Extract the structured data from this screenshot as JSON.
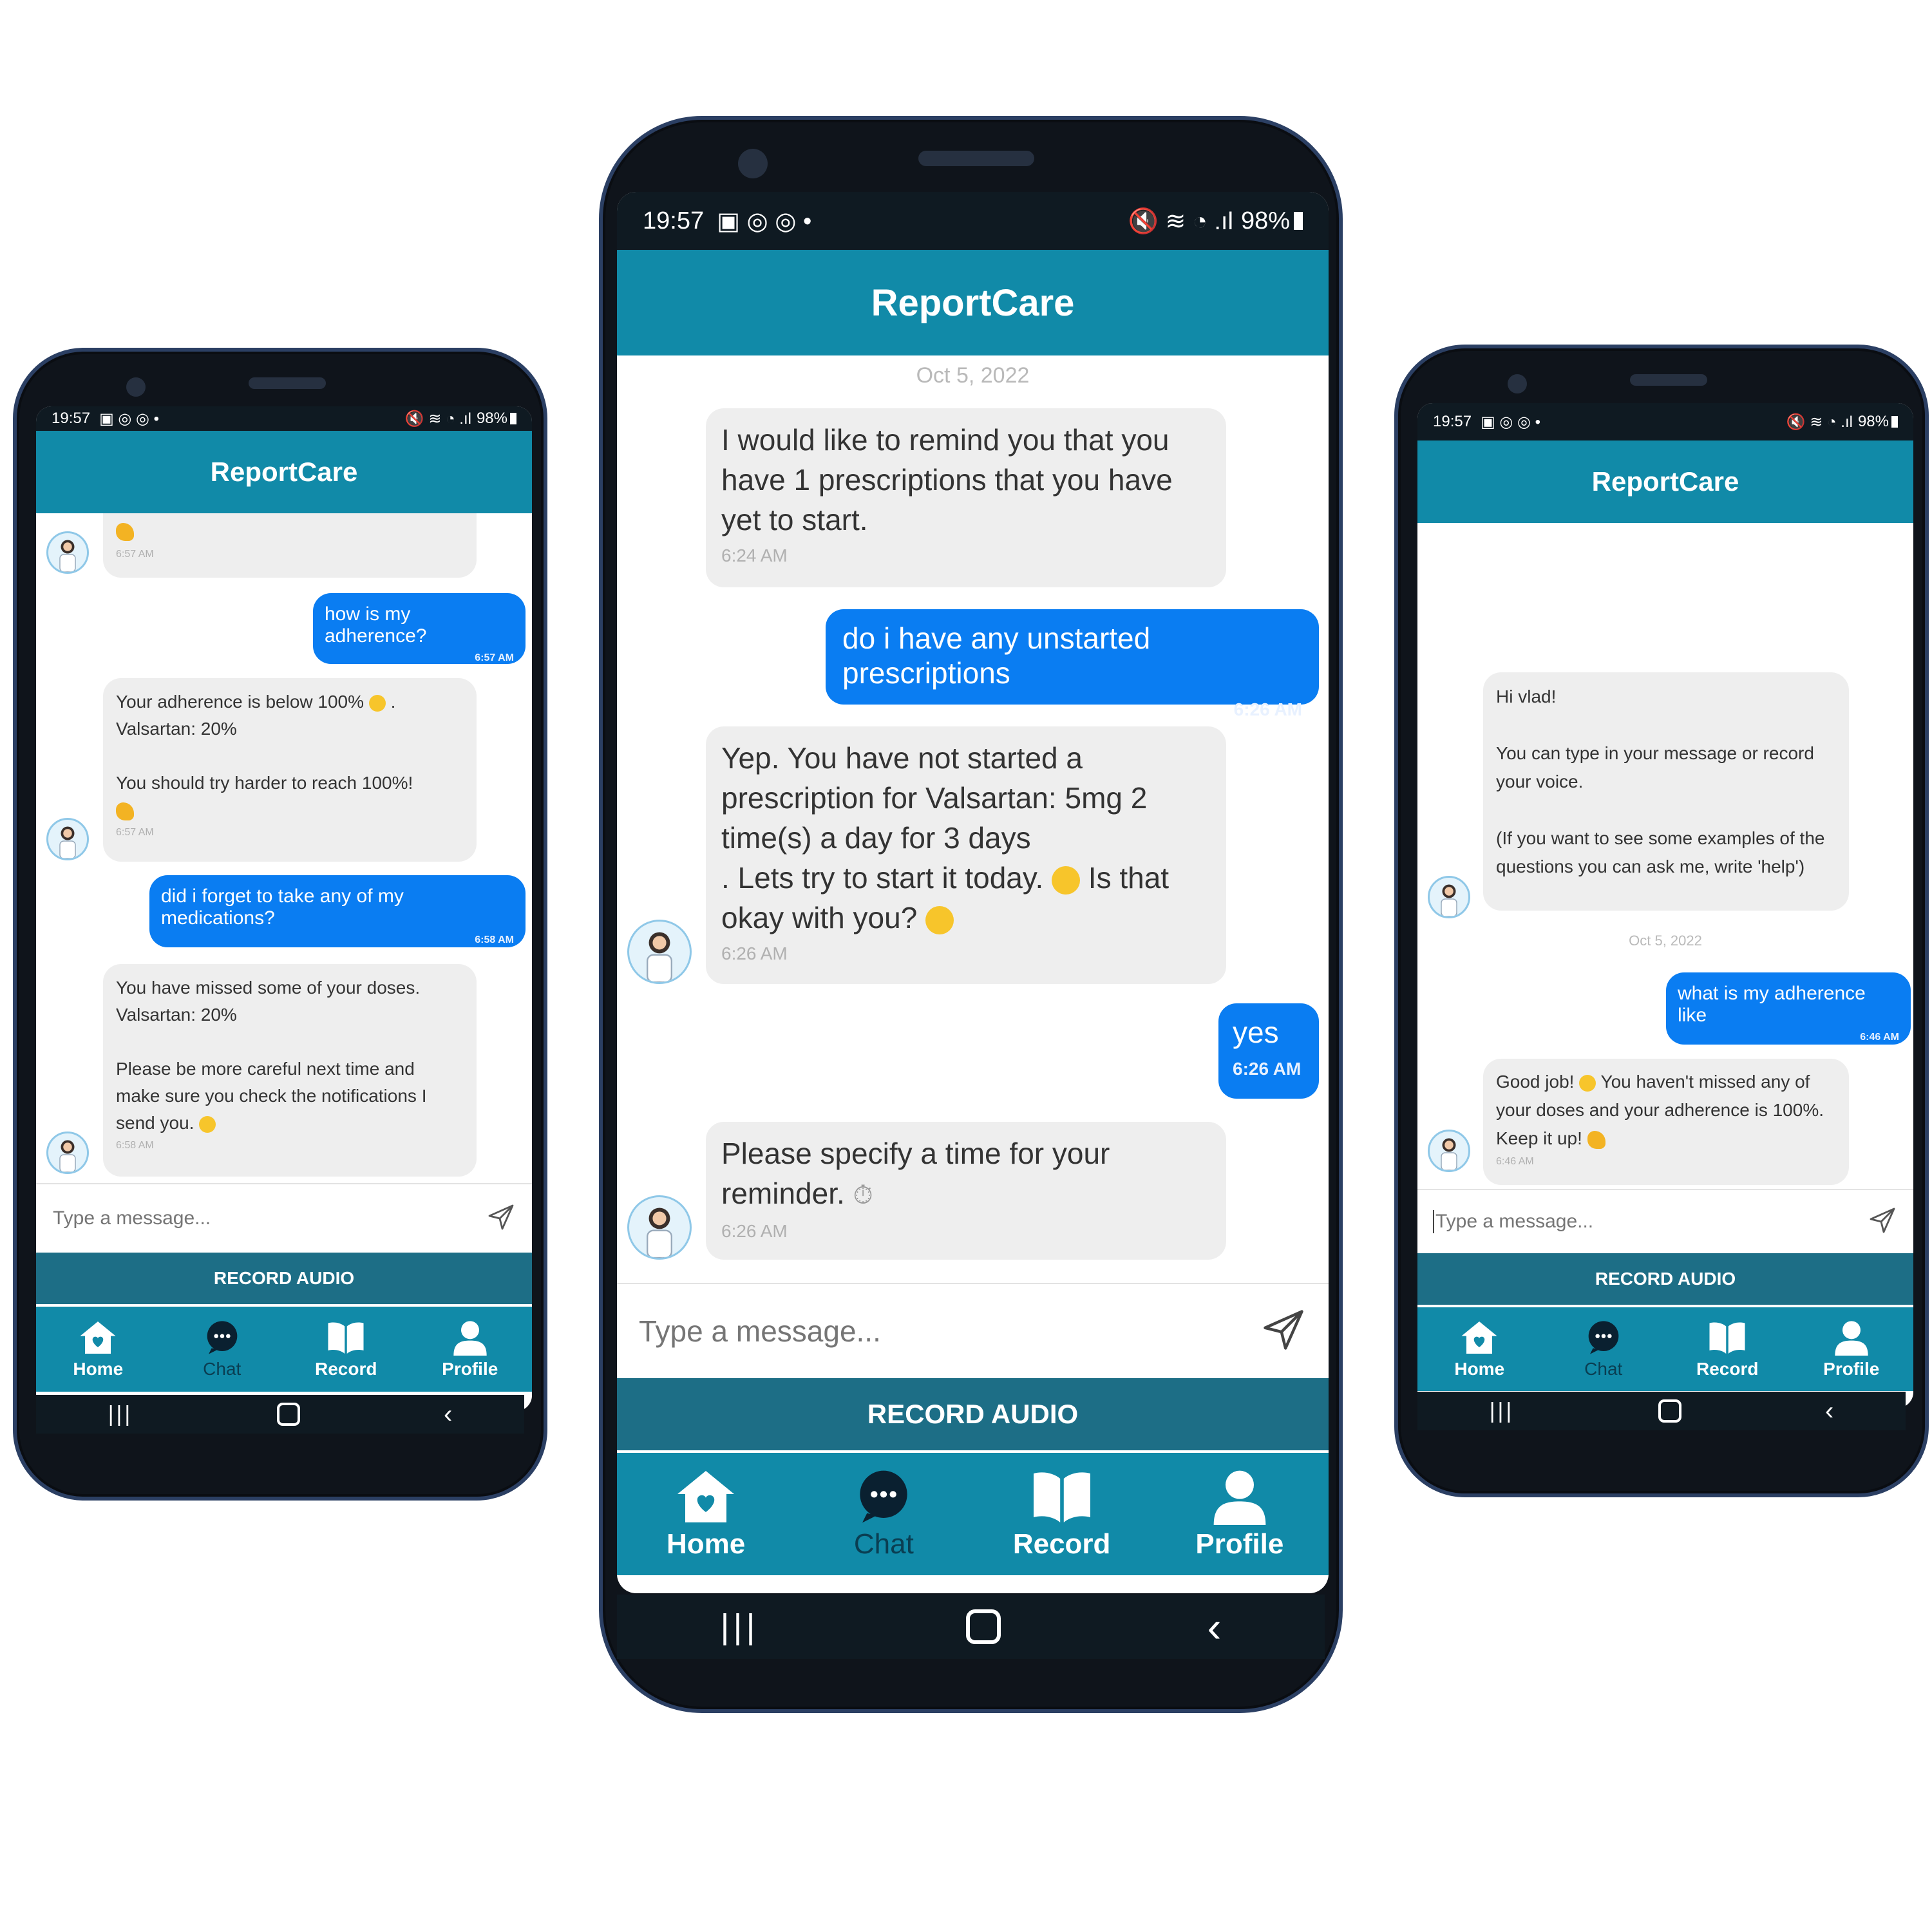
{
  "app": {
    "title": "ReportCare"
  },
  "status": {
    "time": "19:57",
    "battery": "98%"
  },
  "tabs": [
    {
      "label": "Home",
      "icon": "home-heart-icon"
    },
    {
      "label": "Chat",
      "icon": "chat-bubble-icon"
    },
    {
      "label": "Record",
      "icon": "book-icon"
    },
    {
      "label": "Profile",
      "icon": "user-icon"
    }
  ],
  "composer": {
    "placeholder": "Type a message...",
    "record_label": "RECORD AUDIO"
  },
  "colors": {
    "appbar": "#118aa8",
    "user_bubble": "#0a7df2",
    "bot_bubble": "#eeeeee",
    "record_bar": "#1d6e86"
  },
  "left_phone": {
    "messages": [
      {
        "from": "bot",
        "text": "",
        "time": "6:57 AM"
      },
      {
        "from": "user",
        "text": "how is my adherence?",
        "time": "6:57 AM"
      },
      {
        "from": "bot",
        "text": "Your adherence is below 100%",
        "text2": ".\n Valsartan: 20%\n\nYou should try harder to reach 100%!",
        "time": "6:57 AM"
      },
      {
        "from": "user",
        "text": "did i forget to take any of my medications?",
        "time": "6:58 AM"
      },
      {
        "from": "bot",
        "text": "You have missed some of your doses.\nValsartan: 20%\n\nPlease be more careful next time and make sure you check the notifications I send you.",
        "time": "6:58 AM"
      }
    ]
  },
  "center_phone": {
    "date": "Oct 5, 2022",
    "messages": [
      {
        "from": "bot",
        "text": "I would like to remind you that you have 1 prescriptions that you have yet to start.",
        "time": "6:24 AM"
      },
      {
        "from": "user",
        "text": "do i have any unstarted prescriptions",
        "time": "6:26 AM"
      },
      {
        "from": "bot",
        "text": "Yep. You have not started a prescription for Valsartan: 5mg 2 time(s) a day for 3 days\n. Lets try to start it today.",
        "text2": "Is that okay with you?",
        "time": "6:26 AM"
      },
      {
        "from": "user",
        "text": "yes",
        "time": "6:26 AM"
      },
      {
        "from": "bot",
        "text": "Please specify a time for your reminder.",
        "time": "6:26 AM"
      }
    ]
  },
  "right_phone": {
    "date": "Oct 5, 2022",
    "messages": [
      {
        "from": "bot",
        "text": "Hi vlad!\n\nYou can type in your message or record your voice.\n\n(If you want to see some examples of the questions you can ask me, write 'help')",
        "time": ""
      },
      {
        "from": "user",
        "text": "what is my adherence like",
        "time": "6:46 AM"
      },
      {
        "from": "bot",
        "text": "Good job!",
        "text2": "You haven't missed any of your doses and your adherence is 100%. Keep it up!",
        "time": "6:46 AM"
      }
    ]
  }
}
